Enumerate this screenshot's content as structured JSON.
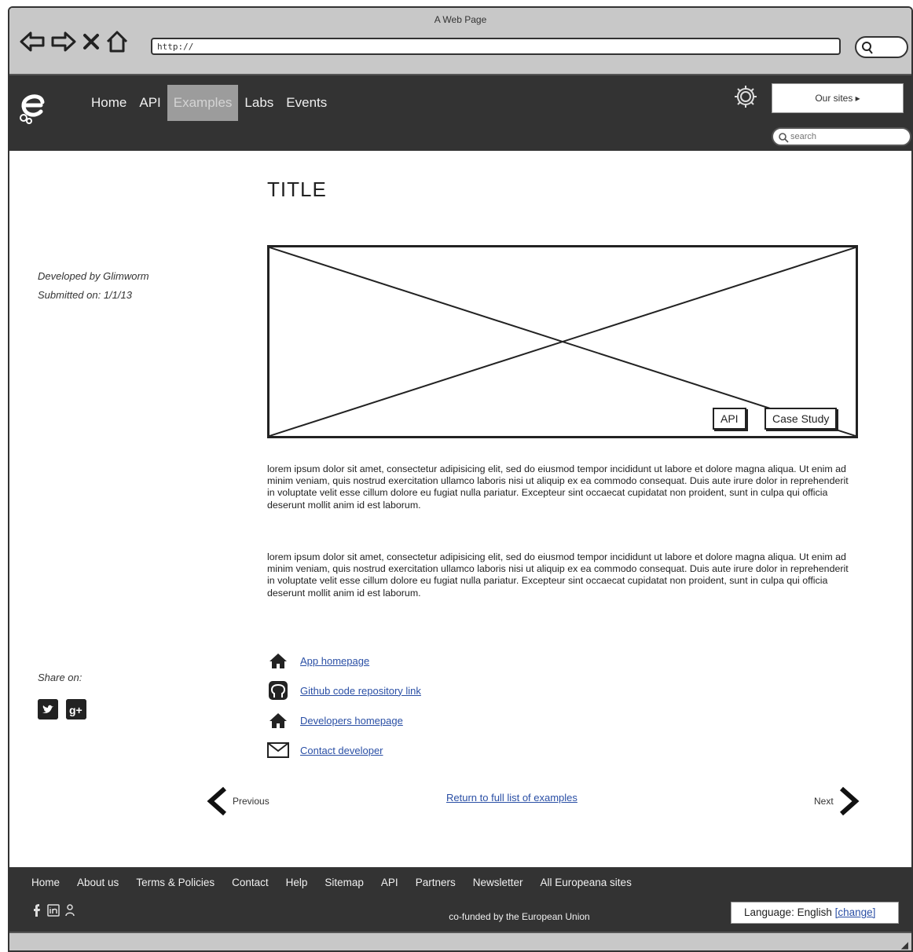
{
  "window": {
    "title": "A Web Page",
    "url": "http://"
  },
  "header": {
    "nav": [
      "Home",
      "API",
      "Examples",
      "Labs",
      "Events"
    ],
    "active_index": 2,
    "button_label": "Our sites ▸",
    "search_placeholder": "search"
  },
  "sidebar": {
    "developed_by": "Developed by Glimworm",
    "submitted_on": "Submitted on: 1/1/13",
    "share_label": "Share on:"
  },
  "content": {
    "title": "TITLE",
    "hero_buttons": {
      "api": "API",
      "case_study": "Case Study"
    },
    "paragraph_1": "lorem ipsum dolor sit amet, consectetur adipisicing elit, sed do eiusmod tempor incididunt ut labore et dolore magna aliqua. Ut enim ad minim veniam, quis nostrud exercitation ullamco laboris nisi ut aliquip ex ea commodo consequat. Duis aute irure dolor in reprehenderit in voluptate velit esse cillum dolore eu fugiat nulla pariatur. Excepteur sint occaecat cupidatat non proident, sunt in culpa qui officia deserunt mollit anim id est laborum.",
    "paragraph_2": "lorem ipsum dolor sit amet, consectetur adipisicing elit, sed do eiusmod tempor incididunt ut labore et dolore magna aliqua. Ut enim ad minim veniam, quis nostrud exercitation ullamco laboris nisi ut aliquip ex ea commodo consequat. Duis aute irure dolor in reprehenderit in voluptate velit esse cillum dolore eu fugiat nulla pariatur. Excepteur sint occaecat cupidatat non proident, sunt in culpa qui officia deserunt mollit anim id est laborum.",
    "links": [
      {
        "icon": "home-icon",
        "label": "App homepage"
      },
      {
        "icon": "github-icon",
        "label": "Github code repository link"
      },
      {
        "icon": "home-icon",
        "label": "Developers homepage"
      },
      {
        "icon": "mail-icon",
        "label": "Contact developer"
      }
    ]
  },
  "pager": {
    "prev": "Previous",
    "center": "Return to full list of examples",
    "next": "Next"
  },
  "footer": {
    "nav": [
      "Home",
      "About us",
      "Terms & Policies",
      "Contact",
      "Help",
      "Sitemap",
      "API",
      "Partners",
      "Newsletter",
      "All Europeana sites"
    ],
    "cofunded": "co-funded by the European Union",
    "language_label": "Language: English",
    "language_change": "[change]"
  }
}
